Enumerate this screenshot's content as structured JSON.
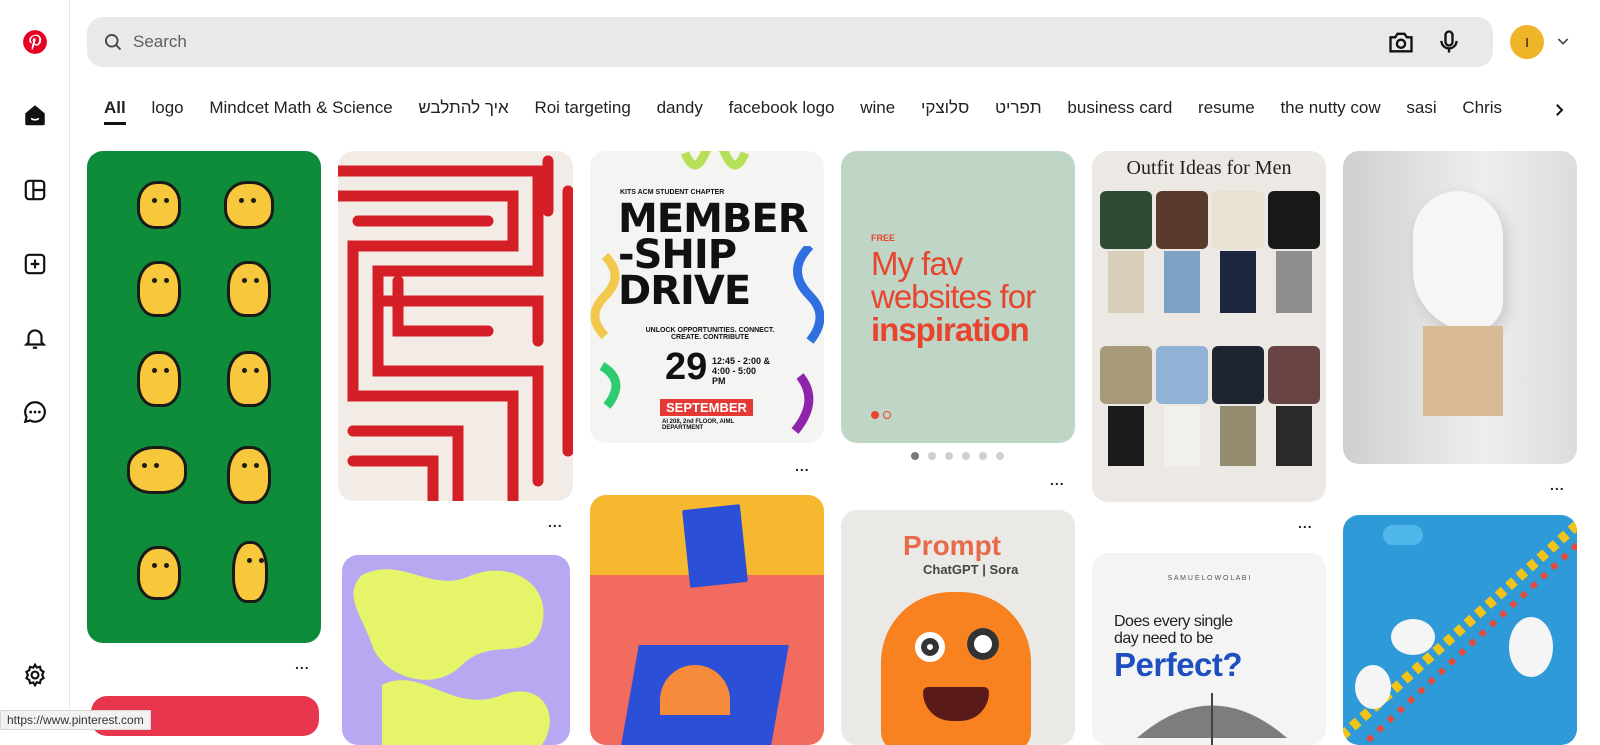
{
  "search": {
    "placeholder": "Search"
  },
  "account": {
    "initial": "I"
  },
  "chips": [
    "All",
    "logo",
    "Mindcet Math & Science",
    "איך להתלבש",
    "Roi targeting",
    "dandy",
    "facebook logo",
    "wine",
    "סלוצקי",
    "תפריט",
    "business card",
    "resume",
    "the nutty cow",
    "sasi",
    "Chris"
  ],
  "pins": {
    "membership": {
      "chapter": "KITS ACM STUDENT CHAPTER",
      "title1": "MEMBER",
      "title2": "-SHIP",
      "title3": "DRIVE",
      "tagline": "UNLOCK OPPORTUNITIES. CONNECT. CREATE. CONTRIBUTE",
      "day": "29",
      "time": "12:45 - 2:00 & 4:00 - 5:00 PM",
      "month": "SEPTEMBER",
      "venue": "AI 208, 2nd FLOOR, AIML DEPARTMENT"
    },
    "websites": {
      "free": "FREE",
      "line1": "My fav",
      "line2": "websites for",
      "line3": "inspiration"
    },
    "outfits": {
      "title": "Outfit Ideas for Men"
    },
    "prompt": {
      "title": "Prompt",
      "subtitle": "ChatGPT | Sora"
    },
    "perfect": {
      "brand": "S A M U E L O W O L A B I",
      "line1": "Does every single",
      "line2": "day need to be",
      "line3": "Perfect?"
    }
  },
  "more_label": "...",
  "status_url": "https://www.pinterest.com",
  "colors": {
    "brand": "#e60023",
    "avatar": "#f0b429"
  }
}
